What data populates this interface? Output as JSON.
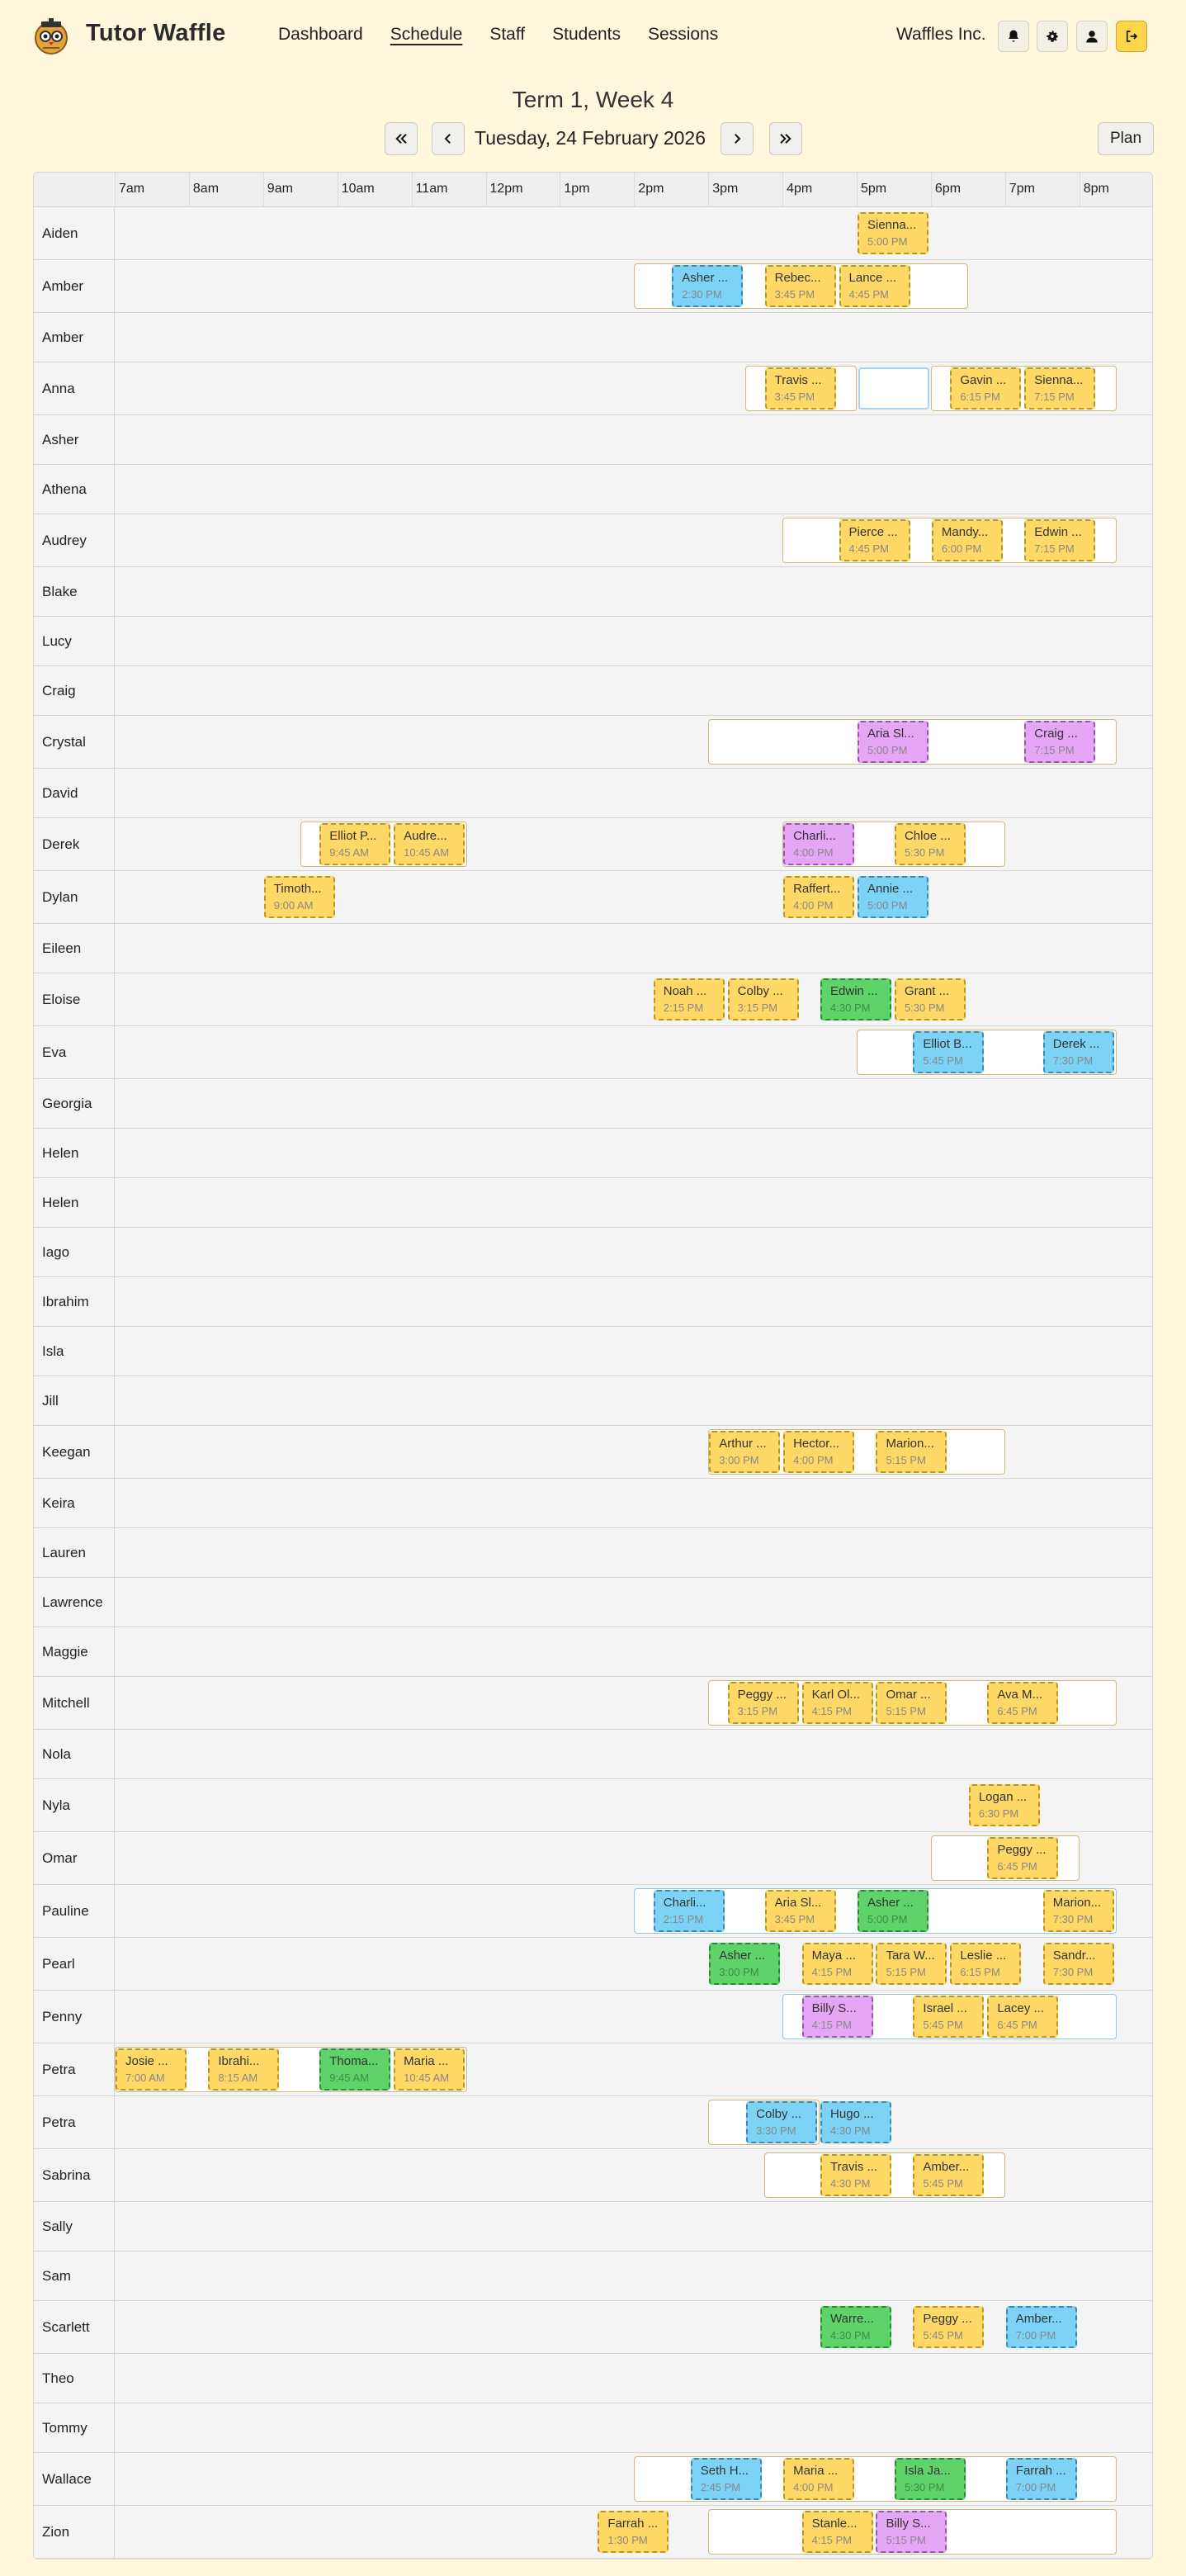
{
  "app": {
    "brand": "Tutor Waffle",
    "org": "Waffles Inc."
  },
  "nav": {
    "dashboard": "Dashboard",
    "schedule": "Schedule",
    "staff": "Staff",
    "students": "Students",
    "sessions": "Sessions"
  },
  "header": {
    "term": "Term 1, Week 4",
    "date": "Tuesday, 24 February 2026",
    "plan": "Plan"
  },
  "icons": {
    "bell": "bell-icon",
    "settings": "gear-icon",
    "account": "user-icon",
    "logout": "logout-icon",
    "first": "double-chevron-left-icon",
    "prev": "chevron-left-icon",
    "next": "chevron-right-icon",
    "last": "double-chevron-right-icon"
  },
  "colors": {
    "background": "#fff8dc",
    "session_yellow": "#ffd866",
    "session_blue": "#7dd3f5",
    "session_green": "#5ed36a",
    "session_purple": "#e4a6f5",
    "accent": "#ffd54a"
  },
  "hours": [
    "7am",
    "8am",
    "9am",
    "10am",
    "11am",
    "12pm",
    "1pm",
    "2pm",
    "3pm",
    "4pm",
    "5pm",
    "6pm",
    "7pm",
    "8pm"
  ],
  "rows": [
    {
      "name": "Aiden",
      "shifts": [],
      "sessions": [
        {
          "label": "Sienna...",
          "time": "5:00 PM",
          "start": 17.0,
          "color": "yellow"
        }
      ]
    },
    {
      "name": "Amber",
      "shifts": [
        {
          "start": 14.0,
          "end": 18.5
        }
      ],
      "sessions": [
        {
          "label": "Asher ...",
          "time": "2:30 PM",
          "start": 14.5,
          "color": "blue"
        },
        {
          "label": "Rebec...",
          "time": "3:45 PM",
          "start": 15.75,
          "color": "yellow"
        },
        {
          "label": "Lance ...",
          "time": "4:45 PM",
          "start": 16.75,
          "color": "yellow"
        }
      ]
    },
    {
      "name": "Amber",
      "shifts": [],
      "sessions": []
    },
    {
      "name": "Anna",
      "shifts": [
        {
          "start": 15.5,
          "end": 17.0
        },
        {
          "start": 18.0,
          "end": 20.5
        }
      ],
      "empty": [
        17.0
      ],
      "sessions": [
        {
          "label": "Travis ...",
          "time": "3:45 PM",
          "start": 15.75,
          "color": "yellow"
        },
        {
          "label": "Gavin ...",
          "time": "6:15 PM",
          "start": 18.25,
          "color": "yellow"
        },
        {
          "label": "Sienna...",
          "time": "7:15 PM",
          "start": 19.25,
          "color": "yellow"
        }
      ]
    },
    {
      "name": "Asher",
      "shifts": [],
      "sessions": []
    },
    {
      "name": "Athena",
      "shifts": [],
      "sessions": []
    },
    {
      "name": "Audrey",
      "shifts": [
        {
          "start": 16.0,
          "end": 20.5
        }
      ],
      "sessions": [
        {
          "label": "Pierce ...",
          "time": "4:45 PM",
          "start": 16.75,
          "color": "yellow"
        },
        {
          "label": "Mandy...",
          "time": "6:00 PM",
          "start": 18.0,
          "color": "yellow"
        },
        {
          "label": "Edwin ...",
          "time": "7:15 PM",
          "start": 19.25,
          "color": "yellow"
        }
      ]
    },
    {
      "name": "Blake",
      "shifts": [],
      "sessions": []
    },
    {
      "name": "Lucy",
      "shifts": [],
      "sessions": []
    },
    {
      "name": "Craig",
      "shifts": [],
      "sessions": []
    },
    {
      "name": "Crystal",
      "shifts": [
        {
          "start": 15.0,
          "end": 20.5
        }
      ],
      "sessions": [
        {
          "label": "Aria Sl...",
          "time": "5:00 PM",
          "start": 17.0,
          "color": "purple"
        },
        {
          "label": "Craig ...",
          "time": "7:15 PM",
          "start": 19.25,
          "color": "purple"
        }
      ]
    },
    {
      "name": "David",
      "shifts": [],
      "sessions": []
    },
    {
      "name": "Derek",
      "shifts": [
        {
          "start": 9.5,
          "end": 11.75
        },
        {
          "start": 16.0,
          "end": 19.0
        }
      ],
      "sessions": [
        {
          "label": "Elliot P...",
          "time": "9:45 AM",
          "start": 9.75,
          "color": "yellow"
        },
        {
          "label": "Audre...",
          "time": "10:45 AM",
          "start": 10.75,
          "color": "yellow"
        },
        {
          "label": "Charli...",
          "time": "4:00 PM",
          "start": 16.0,
          "color": "purple"
        },
        {
          "label": "Chloe ...",
          "time": "5:30 PM",
          "start": 17.5,
          "color": "yellow"
        }
      ]
    },
    {
      "name": "Dylan",
      "shifts": [],
      "sessions": [
        {
          "label": "Timoth...",
          "time": "9:00 AM",
          "start": 9.0,
          "color": "yellow"
        },
        {
          "label": "Raffert...",
          "time": "4:00 PM",
          "start": 16.0,
          "color": "yellow"
        },
        {
          "label": "Annie ...",
          "time": "5:00 PM",
          "start": 17.0,
          "color": "blue"
        }
      ]
    },
    {
      "name": "Eileen",
      "shifts": [],
      "sessions": []
    },
    {
      "name": "Eloise",
      "shifts": [],
      "sessions": [
        {
          "label": "Noah ...",
          "time": "2:15 PM",
          "start": 14.25,
          "color": "yellow"
        },
        {
          "label": "Colby ...",
          "time": "3:15 PM",
          "start": 15.25,
          "color": "yellow"
        },
        {
          "label": "Edwin ...",
          "time": "4:30 PM",
          "start": 16.5,
          "color": "green"
        },
        {
          "label": "Grant ...",
          "time": "5:30 PM",
          "start": 17.5,
          "color": "yellow"
        }
      ]
    },
    {
      "name": "Eva",
      "shifts": [
        {
          "start": 17.0,
          "end": 20.5
        }
      ],
      "sessions": [
        {
          "label": "Elliot B...",
          "time": "5:45 PM",
          "start": 17.75,
          "color": "blue"
        },
        {
          "label": "Derek ...",
          "time": "7:30 PM",
          "start": 19.5,
          "color": "blue"
        }
      ]
    },
    {
      "name": "Georgia",
      "shifts": [],
      "sessions": []
    },
    {
      "name": "Helen",
      "shifts": [],
      "sessions": []
    },
    {
      "name": "Helen",
      "shifts": [],
      "sessions": []
    },
    {
      "name": "Iago",
      "shifts": [],
      "sessions": []
    },
    {
      "name": "Ibrahim",
      "shifts": [],
      "sessions": []
    },
    {
      "name": "Isla",
      "shifts": [],
      "sessions": []
    },
    {
      "name": "Jill",
      "shifts": [],
      "sessions": []
    },
    {
      "name": "Keegan",
      "shifts": [
        {
          "start": 15.0,
          "end": 19.0
        }
      ],
      "sessions": [
        {
          "label": "Arthur ...",
          "time": "3:00 PM",
          "start": 15.0,
          "color": "yellow"
        },
        {
          "label": "Hector...",
          "time": "4:00 PM",
          "start": 16.0,
          "color": "yellow"
        },
        {
          "label": "Marion...",
          "time": "5:15 PM",
          "start": 17.25,
          "color": "yellow"
        }
      ]
    },
    {
      "name": "Keira",
      "shifts": [],
      "sessions": []
    },
    {
      "name": "Lauren",
      "shifts": [],
      "sessions": []
    },
    {
      "name": "Lawrence",
      "shifts": [],
      "sessions": []
    },
    {
      "name": "Maggie",
      "shifts": [],
      "sessions": []
    },
    {
      "name": "Mitchell",
      "shifts": [
        {
          "start": 15.0,
          "end": 20.5
        }
      ],
      "sessions": [
        {
          "label": "Peggy ...",
          "time": "3:15 PM",
          "start": 15.25,
          "color": "yellow"
        },
        {
          "label": "Karl Ol...",
          "time": "4:15 PM",
          "start": 16.25,
          "color": "yellow"
        },
        {
          "label": "Omar ...",
          "time": "5:15 PM",
          "start": 17.25,
          "color": "yellow"
        },
        {
          "label": "Ava M...",
          "time": "6:45 PM",
          "start": 18.75,
          "color": "yellow"
        }
      ]
    },
    {
      "name": "Nola",
      "shifts": [],
      "sessions": []
    },
    {
      "name": "Nyla",
      "shifts": [],
      "sessions": [
        {
          "label": "Logan ...",
          "time": "6:30 PM",
          "start": 18.5,
          "color": "yellow"
        }
      ]
    },
    {
      "name": "Omar",
      "shifts": [
        {
          "start": 18.0,
          "end": 20.0
        }
      ],
      "sessions": [
        {
          "label": "Peggy ...",
          "time": "6:45 PM",
          "start": 18.75,
          "color": "yellow"
        }
      ]
    },
    {
      "name": "Pauline",
      "shifts": [
        {
          "start": 14.0,
          "end": 20.5,
          "color": "blue"
        }
      ],
      "sessions": [
        {
          "label": "Charli...",
          "time": "2:15 PM",
          "start": 14.25,
          "color": "blue"
        },
        {
          "label": "Aria Sl...",
          "time": "3:45 PM",
          "start": 15.75,
          "color": "yellow"
        },
        {
          "label": "Asher ...",
          "time": "5:00 PM",
          "start": 17.0,
          "color": "green"
        },
        {
          "label": "Marion...",
          "time": "7:30 PM",
          "start": 19.5,
          "color": "yellow"
        }
      ]
    },
    {
      "name": "Pearl",
      "shifts": [],
      "sessions": [
        {
          "label": "Asher ...",
          "time": "3:00 PM",
          "start": 15.0,
          "color": "green"
        },
        {
          "label": "Maya ...",
          "time": "4:15 PM",
          "start": 16.25,
          "color": "yellow"
        },
        {
          "label": "Tara W...",
          "time": "5:15 PM",
          "start": 17.25,
          "color": "yellow"
        },
        {
          "label": "Leslie ...",
          "time": "6:15 PM",
          "start": 18.25,
          "color": "yellow"
        },
        {
          "label": "Sandr...",
          "time": "7:30 PM",
          "start": 19.5,
          "color": "yellow"
        }
      ]
    },
    {
      "name": "Penny",
      "shifts": [
        {
          "start": 16.0,
          "end": 20.5,
          "color": "blue"
        }
      ],
      "sessions": [
        {
          "label": "Billy S...",
          "time": "4:15 PM",
          "start": 16.25,
          "color": "purple"
        },
        {
          "label": "Israel ...",
          "time": "5:45 PM",
          "start": 17.75,
          "color": "yellow"
        },
        {
          "label": "Lacey ...",
          "time": "6:45 PM",
          "start": 18.75,
          "color": "yellow"
        }
      ]
    },
    {
      "name": "Petra",
      "shifts": [
        {
          "start": 7.0,
          "end": 11.75
        }
      ],
      "sessions": [
        {
          "label": "Josie ...",
          "time": "7:00 AM",
          "start": 7.0,
          "color": "yellow"
        },
        {
          "label": "Ibrahi...",
          "time": "8:15 AM",
          "start": 8.25,
          "color": "yellow"
        },
        {
          "label": "Thoma...",
          "time": "9:45 AM",
          "start": 9.75,
          "color": "green"
        },
        {
          "label": "Maria ...",
          "time": "10:45 AM",
          "start": 10.75,
          "color": "yellow"
        }
      ]
    },
    {
      "name": "Petra",
      "shifts": [
        {
          "start": 15.0,
          "end": 16.5
        }
      ],
      "sessions": [
        {
          "label": "Colby ...",
          "time": "3:30 PM",
          "start": 15.5,
          "color": "blue"
        },
        {
          "label": "Hugo ...",
          "time": "4:30 PM",
          "start": 16.5,
          "color": "blue"
        }
      ]
    },
    {
      "name": "Sabrina",
      "shifts": [
        {
          "start": 15.75,
          "end": 19.0
        }
      ],
      "sessions": [
        {
          "label": "Travis ...",
          "time": "4:30 PM",
          "start": 16.5,
          "color": "yellow"
        },
        {
          "label": "Amber...",
          "time": "5:45 PM",
          "start": 17.75,
          "color": "yellow"
        }
      ]
    },
    {
      "name": "Sally",
      "shifts": [],
      "sessions": []
    },
    {
      "name": "Sam",
      "shifts": [],
      "sessions": []
    },
    {
      "name": "Scarlett",
      "shifts": [],
      "sessions": [
        {
          "label": "Warre...",
          "time": "4:30 PM",
          "start": 16.5,
          "color": "green"
        },
        {
          "label": "Peggy ...",
          "time": "5:45 PM",
          "start": 17.75,
          "color": "yellow"
        },
        {
          "label": "Amber...",
          "time": "7:00 PM",
          "start": 19.0,
          "color": "blue"
        }
      ]
    },
    {
      "name": "Theo",
      "shifts": [],
      "sessions": []
    },
    {
      "name": "Tommy",
      "shifts": [],
      "sessions": []
    },
    {
      "name": "Wallace",
      "shifts": [
        {
          "start": 14.0,
          "end": 20.5
        }
      ],
      "sessions": [
        {
          "label": "Seth H...",
          "time": "2:45 PM",
          "start": 14.75,
          "color": "blue"
        },
        {
          "label": "Maria ...",
          "time": "4:00 PM",
          "start": 16.0,
          "color": "yellow"
        },
        {
          "label": "Isla Ja...",
          "time": "5:30 PM",
          "start": 17.5,
          "color": "green"
        },
        {
          "label": "Farrah ...",
          "time": "7:00 PM",
          "start": 19.0,
          "color": "blue"
        }
      ]
    },
    {
      "name": "Zion",
      "shifts": [
        {
          "start": 15.0,
          "end": 20.5
        }
      ],
      "sessions": [
        {
          "label": "Farrah ...",
          "time": "1:30 PM",
          "start": 13.5,
          "color": "yellow"
        },
        {
          "label": "Stanle...",
          "time": "4:15 PM",
          "start": 16.25,
          "color": "yellow"
        },
        {
          "label": "Billy S...",
          "time": "5:15 PM",
          "start": 17.25,
          "color": "purple"
        }
      ]
    }
  ]
}
